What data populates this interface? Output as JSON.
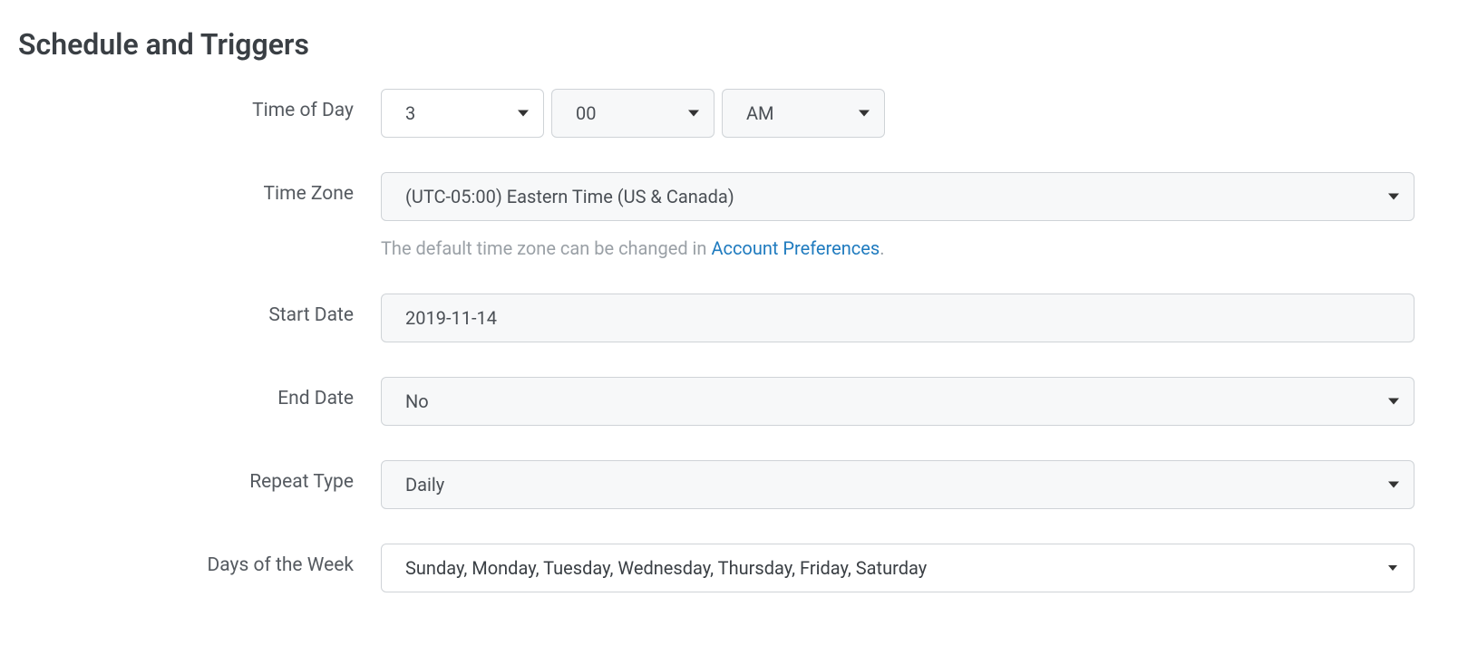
{
  "section": {
    "title": "Schedule and Triggers"
  },
  "labels": {
    "time_of_day": "Time of Day",
    "time_zone": "Time Zone",
    "start_date": "Start Date",
    "end_date": "End Date",
    "repeat_type": "Repeat Type",
    "days_of_week": "Days of the Week"
  },
  "values": {
    "hour": "3",
    "minute": "00",
    "meridiem": "AM",
    "time_zone": "(UTC-05:00) Eastern Time (US & Canada)",
    "start_date": "2019-11-14",
    "end_date": "No",
    "repeat_type": "Daily",
    "days_of_week": "Sunday, Monday, Tuesday, Wednesday, Thursday, Friday, Saturday"
  },
  "hint": {
    "prefix": "The default time zone can be changed in ",
    "link": "Account Preferences",
    "suffix": "."
  }
}
